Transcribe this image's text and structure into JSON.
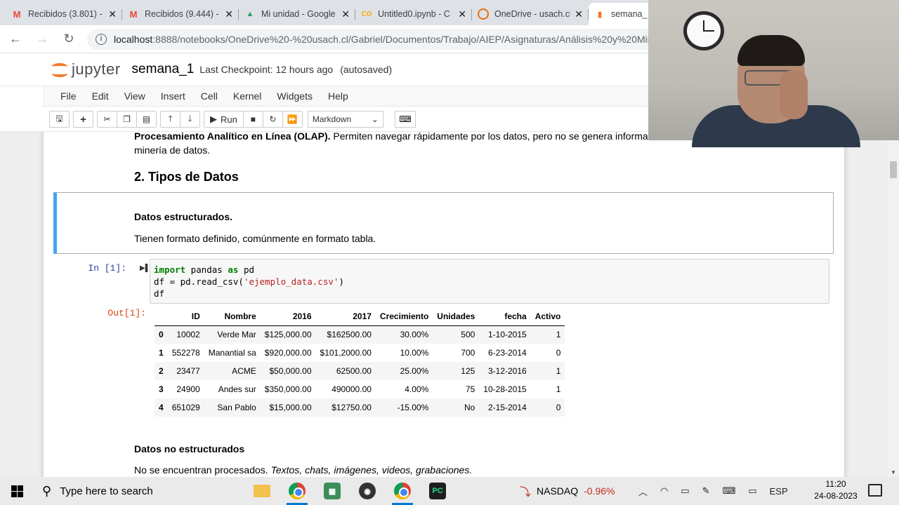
{
  "browser": {
    "tabs": [
      {
        "title": "Recibidos (3.801) - ",
        "icon": "gmail-icon"
      },
      {
        "title": "Recibidos (9.444) - ",
        "icon": "gmail-icon"
      },
      {
        "title": "Mi unidad - Google",
        "icon": "drive-icon"
      },
      {
        "title": "Untitled0.ipynb - C",
        "icon": "colab-icon"
      },
      {
        "title": "OneDrive - usach.cl",
        "icon": "onedrive-icon"
      },
      {
        "title": "semana_",
        "icon": "jupyter-icon",
        "active": true
      }
    ],
    "url_host": "localhost",
    "url_path": ":8888/notebooks/OneDrive%20-%20usach.cl/Gabriel/Documentos/Trabajo/AIEP/Asignaturas/Análisis%20y%20Minería"
  },
  "jupyter": {
    "logo_text": "jupyter",
    "notebook_name": "semana_1",
    "checkpoint": "Last Checkpoint: 12 hours ago",
    "autosave": "(autosaved)",
    "menu": [
      "File",
      "Edit",
      "View",
      "Insert",
      "Cell",
      "Kernel",
      "Widgets",
      "Help"
    ],
    "toolbar": {
      "run_label": "Run",
      "cell_type": "Markdown"
    }
  },
  "notebook": {
    "prev_bold": "Procesamiento Analítico en Línea (OLAP).",
    "prev_rest": " Permiten navegar rápidamente por los datos, pero no se genera informa",
    "prev_line2": "minería de datos.",
    "section_title": "2. Tipos de Datos",
    "md_heading": "Datos estructurados.",
    "md_text": "Tienen formato definido, comúnmente en formato tabla.",
    "in_prompt": "In [1]:",
    "out_prompt": "Out[1]:",
    "code": {
      "l1_kw1": "import",
      "l1_mid": " pandas ",
      "l1_kw2": "as",
      "l1_end": " pd",
      "l2_start": "df = pd.read_csv(",
      "l2_str": "'ejemplo_data.csv'",
      "l2_end": ")",
      "l3": "df"
    },
    "table": {
      "columns": [
        "",
        "ID",
        "Nombre",
        "2016",
        "2017",
        "Crecimiento",
        "Unidades",
        "fecha",
        "Activo"
      ],
      "rows": [
        [
          "0",
          "10002",
          "Verde Mar",
          "$125,000.00",
          "$162500.00",
          "30.00%",
          "500",
          "1-10-2015",
          "1"
        ],
        [
          "1",
          "552278",
          "Manantial sa",
          "$920,000.00",
          "$101,2000.00",
          "10.00%",
          "700",
          "6-23-2014",
          "0"
        ],
        [
          "2",
          "23477",
          "ACME",
          "$50,000.00",
          "62500.00",
          "25.00%",
          "125",
          "3-12-2016",
          "1"
        ],
        [
          "3",
          "24900",
          "Andes sur",
          "$350,000.00",
          "490000.00",
          "4.00%",
          "75",
          "10-28-2015",
          "1"
        ],
        [
          "4",
          "651029",
          "San Pablo",
          "$15,000.00",
          "$12750.00",
          "-15.00%",
          "No",
          "2-15-2014",
          "0"
        ]
      ]
    },
    "h3": "Datos no estructurados",
    "last_plain": "No se encuentran procesados. ",
    "last_italic": "Textos, chats, imágenes, videos, grabaciones."
  },
  "taskbar": {
    "search_placeholder": "Type here to search",
    "stock_name": "NASDAQ",
    "stock_change": "-0.96%",
    "lang": "ESP",
    "time": "11:20",
    "date": "24-08-2023"
  }
}
